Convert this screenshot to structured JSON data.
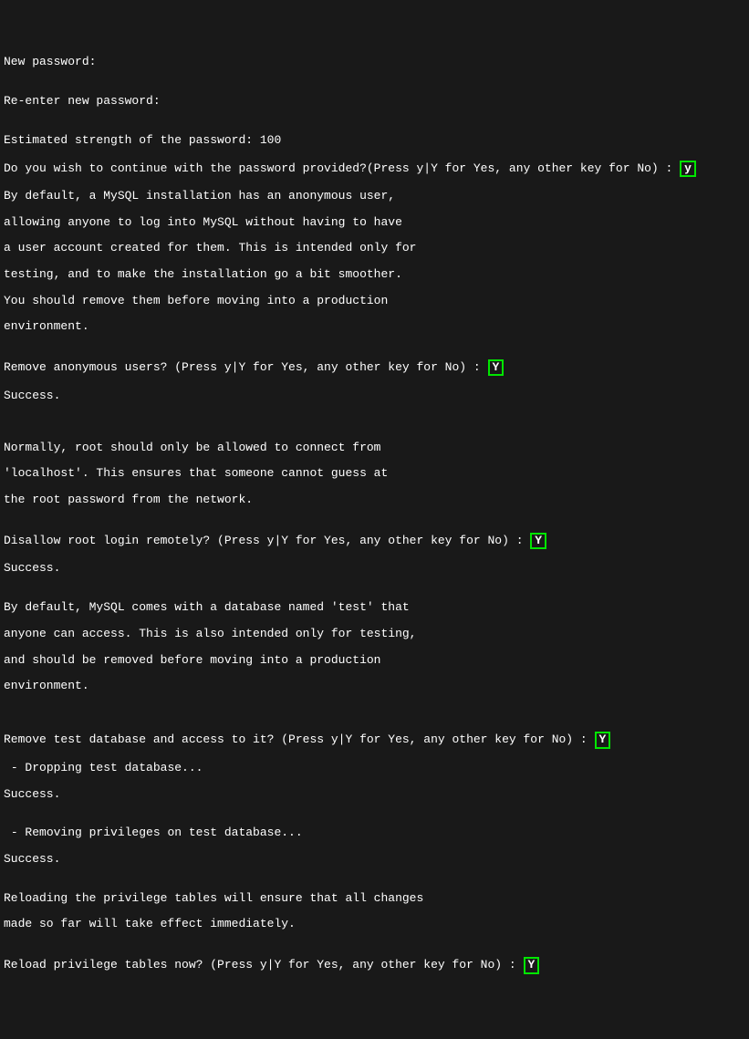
{
  "lines": {
    "l1": "New password:",
    "l2": "",
    "l3": "Re-enter new password:",
    "l4": "",
    "l5": "Estimated strength of the password: 100",
    "l6": "Do you wish to continue with the password provided?(Press y|Y for Yes, any other key for No) : ",
    "l6_input": "y",
    "l7": "By default, a MySQL installation has an anonymous user,",
    "l8": "allowing anyone to log into MySQL without having to have",
    "l9": "a user account created for them. This is intended only for",
    "l10": "testing, and to make the installation go a bit smoother.",
    "l11": "You should remove them before moving into a production",
    "l12": "environment.",
    "l13": "",
    "l14": "Remove anonymous users? (Press y|Y for Yes, any other key for No) : ",
    "l14_input": "Y",
    "l15": "Success.",
    "l16": "",
    "l17": "",
    "l18": "Normally, root should only be allowed to connect from",
    "l19": "'localhost'. This ensures that someone cannot guess at",
    "l20": "the root password from the network.",
    "l21": "",
    "l22": "Disallow root login remotely? (Press y|Y for Yes, any other key for No) : ",
    "l22_input": "Y",
    "l23": "Success.",
    "l24": "",
    "l25": "By default, MySQL comes with a database named 'test' that",
    "l26": "anyone can access. This is also intended only for testing,",
    "l27": "and should be removed before moving into a production",
    "l28": "environment.",
    "l29": "",
    "l30": "",
    "l31": "Remove test database and access to it? (Press y|Y for Yes, any other key for No) : ",
    "l31_input": "Y",
    "l32": " - Dropping test database...",
    "l33": "Success.",
    "l34": "",
    "l35": " - Removing privileges on test database...",
    "l36": "Success.",
    "l37": "",
    "l38": "Reloading the privilege tables will ensure that all changes",
    "l39": "made so far will take effect immediately.",
    "l40": "",
    "l41": "Reload privilege tables now? (Press y|Y for Yes, any other key for No) : ",
    "l41_input": "Y"
  }
}
